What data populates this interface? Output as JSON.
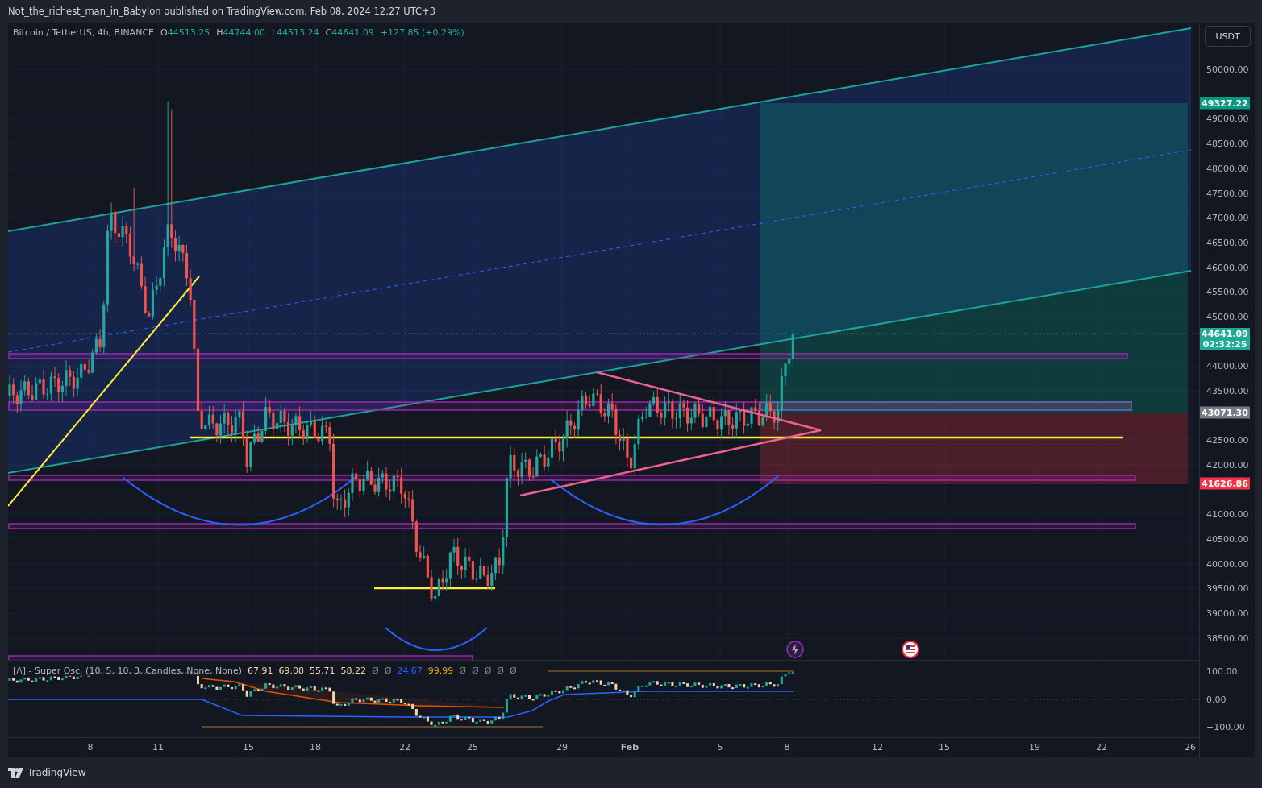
{
  "header": {
    "text": "Not_the_richest_man_in_Babylon published on TradingView.com, Feb 08, 2024 12:27 UTC+3"
  },
  "legend": {
    "symbol": "Bitcoin / TetherUS, 4h, BINANCE",
    "ohlc": [
      {
        "letter": "O",
        "value": "44513.25"
      },
      {
        "letter": "H",
        "value": "44744.00"
      },
      {
        "letter": "L",
        "value": "44513.24"
      },
      {
        "letter": "C",
        "value": "44641.09"
      }
    ],
    "change": "+127.85 (+0.29%)"
  },
  "indicator": {
    "name": "[/\\] - Super Osc. (10, 5, 10, 3, Candles, None, None)",
    "values": [
      {
        "text": "67.91",
        "color": "#f5d6a8"
      },
      {
        "text": "69.08",
        "color": "#f5d6a8"
      },
      {
        "text": "55.71",
        "color": "#f5d6a8"
      },
      {
        "text": "58.22",
        "color": "#f5d6a8"
      },
      {
        "text": "Ø",
        "color": "#868993"
      },
      {
        "text": "Ø",
        "color": "#868993"
      },
      {
        "text": "24.67",
        "color": "#2962ff"
      },
      {
        "text": "99.99",
        "color": "#f0a30a"
      },
      {
        "text": "Ø",
        "color": "#868993"
      },
      {
        "text": "Ø",
        "color": "#868993"
      },
      {
        "text": "Ø",
        "color": "#868993"
      },
      {
        "text": "Ø",
        "color": "#868993"
      },
      {
        "text": "Ø",
        "color": "#868993"
      }
    ]
  },
  "price_axis": {
    "currency": "USDT",
    "ticks": [
      "50000.00",
      "49000.00",
      "48500.00",
      "48000.00",
      "47500.00",
      "47000.00",
      "46500.00",
      "46000.00",
      "45500.00",
      "45000.00",
      "44000.00",
      "43500.00",
      "42500.00",
      "42000.00",
      "41000.00",
      "40500.00",
      "40000.00",
      "39500.00",
      "39000.00",
      "38500.00"
    ],
    "tags": [
      {
        "lines": [
          "49327.22"
        ],
        "color": "#089981"
      },
      {
        "lines": [
          "44641.09",
          "02:32:25"
        ],
        "color": "#22ab94"
      },
      {
        "lines": [
          "43071.30"
        ],
        "color": "#787b86"
      },
      {
        "lines": [
          "41626.86"
        ],
        "color": "#f23645"
      }
    ]
  },
  "oscillator_axis": {
    "ticks": [
      "100.00",
      "0.00",
      "−100.00"
    ]
  },
  "time_axis": {
    "ticks": [
      {
        "label": "8",
        "kind": "day"
      },
      {
        "label": "11",
        "kind": "day"
      },
      {
        "label": "15",
        "kind": "day"
      },
      {
        "label": "18",
        "kind": "day"
      },
      {
        "label": "22",
        "kind": "day"
      },
      {
        "label": "25",
        "kind": "day"
      },
      {
        "label": "29",
        "kind": "day"
      },
      {
        "label": "Feb",
        "kind": "month"
      },
      {
        "label": "5",
        "kind": "day"
      },
      {
        "label": "8",
        "kind": "day"
      },
      {
        "label": "12",
        "kind": "day"
      },
      {
        "label": "15",
        "kind": "day"
      },
      {
        "label": "19",
        "kind": "day"
      },
      {
        "label": "22",
        "kind": "day"
      },
      {
        "label": "26",
        "kind": "day"
      }
    ]
  },
  "footer": {
    "brand": "TradingView"
  }
}
